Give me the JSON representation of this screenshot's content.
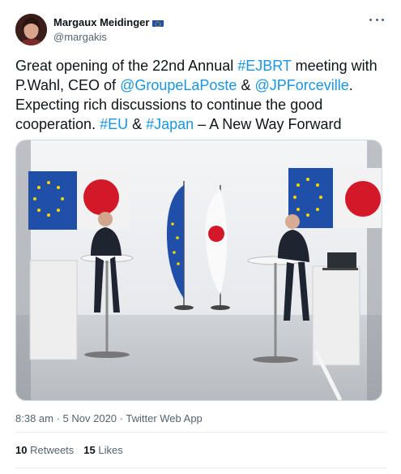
{
  "author": {
    "name": "Margaux Meidinger",
    "handle": "@margakis",
    "badge_icon": "eu-flag-icon"
  },
  "tweet": {
    "segments": [
      {
        "text": "Great opening of the 22nd Annual ",
        "type": "text"
      },
      {
        "text": "#EJBRT",
        "type": "hashtag"
      },
      {
        "text": " meeting with P.Wahl, CEO of ",
        "type": "text"
      },
      {
        "text": "@GroupeLaPoste",
        "type": "mention"
      },
      {
        "text": " & ",
        "type": "text"
      },
      {
        "text": "@JPForceville",
        "type": "mention"
      },
      {
        "text": ". Expecting rich discussions to continue the good cooperation. ",
        "type": "text"
      },
      {
        "text": "#EU",
        "type": "hashtag"
      },
      {
        "text": " & ",
        "type": "text"
      },
      {
        "text": "#Japan",
        "type": "hashtag"
      },
      {
        "text": " – A New Way Forward",
        "type": "text"
      }
    ]
  },
  "meta": {
    "time": "8:38 am",
    "separator": " · ",
    "date": "5 Nov 2020",
    "source_separator": " · ",
    "source": "Twitter Web App"
  },
  "stats": {
    "retweets_count": "10",
    "retweets_label": "Retweets",
    "likes_count": "15",
    "likes_label": "Likes"
  },
  "colors": {
    "link": "#1b95e0",
    "muted": "#536471",
    "eu_blue": "#1f4fa8",
    "japan_red": "#d3182a"
  }
}
